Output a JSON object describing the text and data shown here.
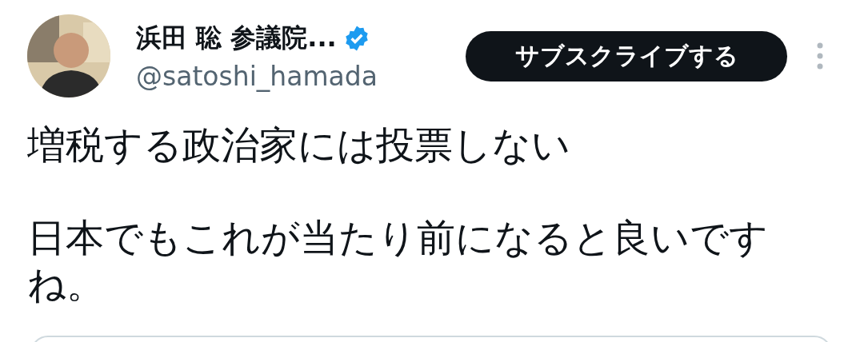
{
  "author": {
    "name": "浜田 聡 参議院...",
    "verified": true,
    "handle": "@satoshi_hamada"
  },
  "subscribe_button": {
    "label": "サブスクライブする"
  },
  "tweet": {
    "paragraphs": [
      "増税する政治家には投票しない",
      "日本でもこれが当たり前になると良いですね。"
    ]
  }
}
